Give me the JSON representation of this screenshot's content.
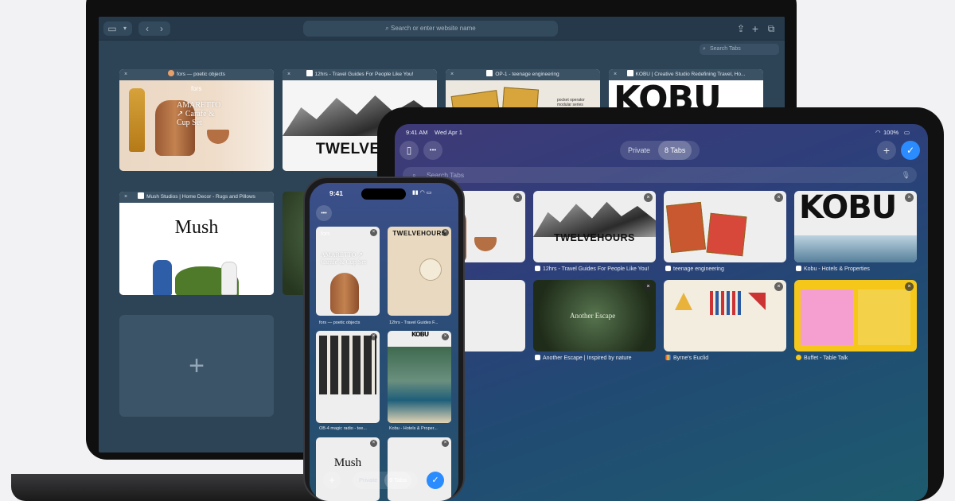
{
  "mac": {
    "url_placeholder": "Search or enter website name",
    "search_tabs": "Search Tabs",
    "tabs": [
      {
        "title": "fors — poetic objects",
        "fav": "#e8a06a"
      },
      {
        "title": "12hrs - Travel Guides For People Like You!",
        "fav": "#ffffff"
      },
      {
        "title": "OP-1 - teenage engineering",
        "fav": "#ffffff"
      },
      {
        "title": "KOBU | Creative Studio Redefining Travel, Ho...",
        "fav": "#ffffff"
      },
      {
        "title": "Mush Studios | Home Decor - Rugs and Pillows",
        "fav": "#ffffff"
      }
    ],
    "thumb_text": {
      "fors_logo": "fors",
      "fors_title": "AMARETTO ↗ Carafe & Cup Set",
      "twelve_word": "TWELVEHO",
      "kobu_word": "KOBU",
      "mush_word": "Mush",
      "teenage_note": "pocket operator\nmodular series"
    },
    "add_tab_symbol": "+"
  },
  "ipad": {
    "time": "9:41 AM",
    "date": "Wed Apr 1",
    "battery": "100%",
    "private_label": "Private",
    "tabs_count": "8 Tabs",
    "search_placeholder": "Search Tabs",
    "add_symbol": "+",
    "check_symbol": "✓",
    "more_symbol": "•••",
    "cards": [
      {
        "label": "poetic objects"
      },
      {
        "label": "12hrs - Travel Guides For People Like You!"
      },
      {
        "label": "teenage engineering"
      },
      {
        "label": "Kobu - Hotels & Properties"
      },
      {
        "label": "Decor - Rugs and Pil..."
      },
      {
        "label": "Another Escape | Inspired by nature"
      },
      {
        "label": "Byrne's Euclid"
      },
      {
        "label": "Buffet - Table Talk"
      }
    ],
    "thumb_text": {
      "twelve_word": "TWELVEHOURS",
      "kobu_word": "KOBU",
      "mush_word": "sh",
      "escape_title": "Another Escape"
    }
  },
  "iphone": {
    "time": "9:41",
    "more_symbol": "•••",
    "private_label": "Private",
    "tabs_count": "8 Tabs",
    "add_symbol": "+",
    "check_symbol": "✓",
    "cards": [
      {
        "label": "fors — poetic objects"
      },
      {
        "label": "12hrs - Travel Guides F..."
      },
      {
        "label": "OB-4 magic radio - tee..."
      },
      {
        "label": "Kobu - Hotels & Proper..."
      }
    ],
    "thumb_text": {
      "fors_logo": "fors",
      "fors_title": "AMARETTO ↗ Carafe & Cup Set",
      "twelve_word": "TWELVEHOURS",
      "kobu_word": "KOBU",
      "mush_word": "Mush"
    }
  }
}
